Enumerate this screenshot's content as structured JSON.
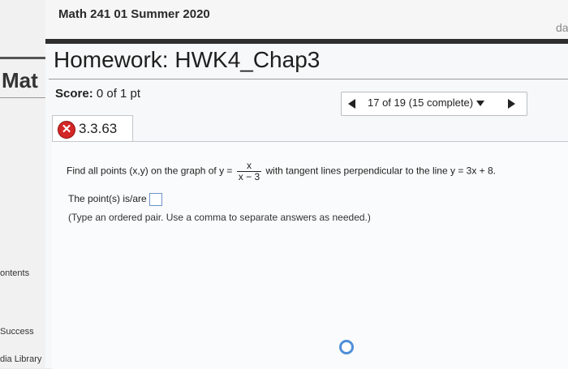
{
  "course": {
    "title": "Math 241 01 Summer 2020"
  },
  "user": {
    "name_fragment": "da"
  },
  "sidebar": {
    "brand": "Mat",
    "items": [
      {
        "label": "ontents"
      },
      {
        "label": "Success"
      },
      {
        "label": "dia Library"
      }
    ]
  },
  "homework": {
    "title": "Homework: HWK4_Chap3",
    "score_label": "Score:",
    "score_value": "0 of 1 pt"
  },
  "pager": {
    "selected": "17 of 19 (15 complete)"
  },
  "question": {
    "status_icon": "x-mark",
    "status_color": "#d32626",
    "number": "3.3.63",
    "text_before": "Find all points (x,y) on the graph of y =",
    "frac_num": "x",
    "frac_den": "x − 3",
    "text_after": "with tangent lines perpendicular to the line y = 3x + 8.",
    "answer_label": "The point(s) is/are",
    "answer_value": "",
    "hint": "(Type an ordered pair. Use a comma to separate answers as needed.)"
  }
}
